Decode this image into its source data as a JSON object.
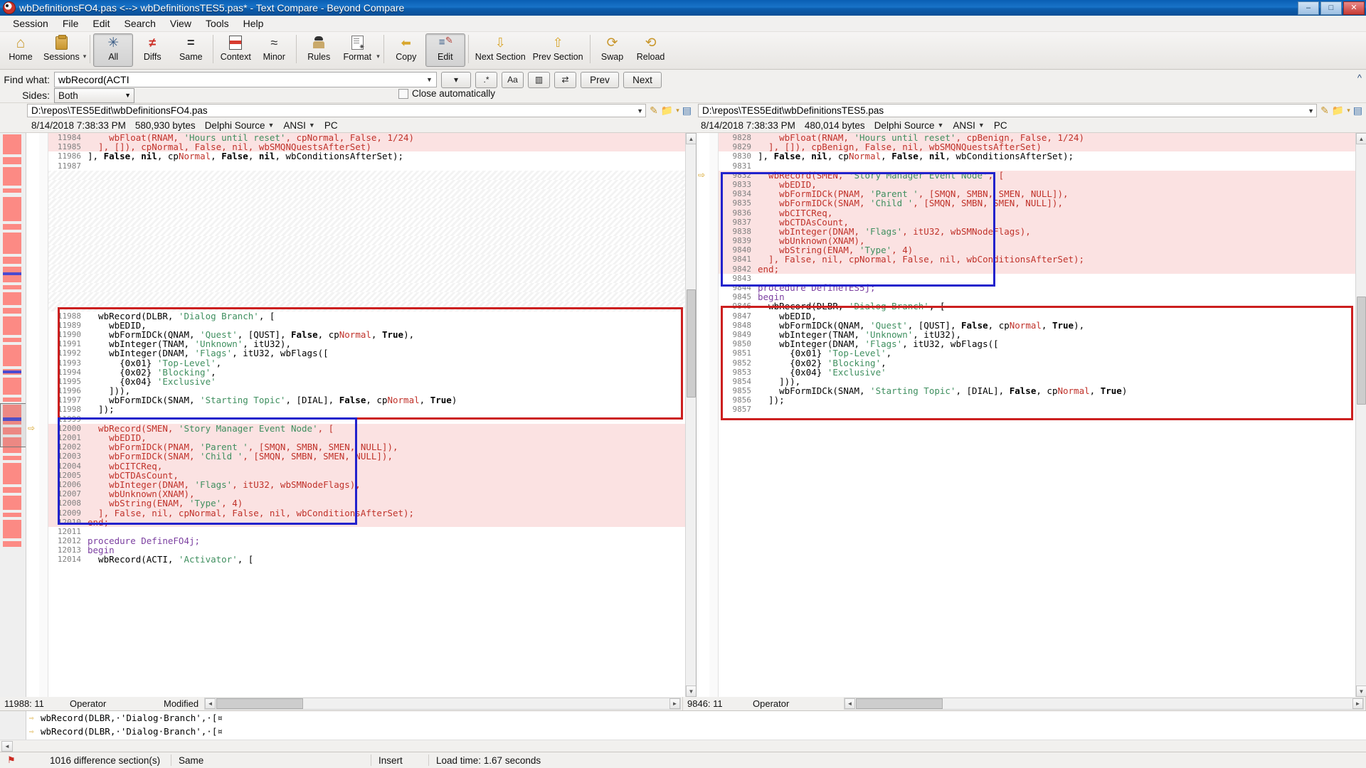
{
  "window": {
    "title": "wbDefinitionsFO4.pas <--> wbDefinitionsTES5.pas* - Text Compare - Beyond Compare",
    "icon": "beyond-compare-icon",
    "minimize": "–",
    "maximize": "□",
    "close": "✕"
  },
  "menu": [
    "Session",
    "File",
    "Edit",
    "Search",
    "View",
    "Tools",
    "Help"
  ],
  "toolbar": [
    {
      "label": "Home",
      "icon": "home-icon",
      "pressed": false
    },
    {
      "label": "Sessions",
      "icon": "sessions-icon",
      "pressed": false,
      "caret": true
    },
    {
      "label": "All",
      "icon": "all-icon",
      "pressed": true
    },
    {
      "label": "Diffs",
      "icon": "diffs-icon",
      "pressed": false
    },
    {
      "label": "Same",
      "icon": "same-icon",
      "pressed": false
    },
    {
      "label": "Context",
      "icon": "context-icon",
      "pressed": false
    },
    {
      "label": "Minor",
      "icon": "minor-icon",
      "pressed": false
    },
    {
      "label": "Rules",
      "icon": "rules-icon",
      "pressed": false
    },
    {
      "label": "Format",
      "icon": "format-icon",
      "pressed": false,
      "caret": true
    },
    {
      "label": "Copy",
      "icon": "copy-left-icon",
      "pressed": false
    },
    {
      "label": "Edit",
      "icon": "edit-icon",
      "pressed": true
    },
    {
      "label": "Next Section",
      "icon": "arrow-down-icon",
      "pressed": false
    },
    {
      "label": "Prev Section",
      "icon": "arrow-up-icon",
      "pressed": false
    },
    {
      "label": "Swap",
      "icon": "swap-icon",
      "pressed": false
    },
    {
      "label": "Reload",
      "icon": "reload-icon",
      "pressed": false
    }
  ],
  "find": {
    "label": "Find what:",
    "value": "wbRecord(ACTI",
    "placeholder": "",
    "history_button": "▾",
    "regex_button": ".*",
    "case_button": "Aa",
    "wholeword_button": "▥",
    "wrap_button": "⇄",
    "prev_button": "Prev",
    "next_button": "Next",
    "sides_label": "Sides:",
    "sides_value": "Both",
    "close_automatically_label": "Close automatically",
    "close_automatically_checked": false,
    "collapse_icon": "^"
  },
  "left_file": {
    "path": "D:\\repos\\TES5Edit\\wbDefinitionsFO4.pas",
    "timestamp": "8/14/2018 7:38:33 PM",
    "size": "580,930 bytes",
    "format": "Delphi Source",
    "encoding": "ANSI",
    "linebreak": "PC"
  },
  "right_file": {
    "path": "D:\\repos\\TES5Edit\\wbDefinitionsTES5.pas",
    "timestamp": "8/14/2018 7:38:33 PM",
    "size": "480,014 bytes",
    "format": "Delphi Source",
    "encoding": "ANSI",
    "linebreak": "PC"
  },
  "left_lines": [
    {
      "n": "11984",
      "t": "    wbFloat(RNAM, 'Hours until reset', cpNormal, False, 1/24)",
      "cls": "diff"
    },
    {
      "n": "11985",
      "t": "  ], []), cpNormal, False, nil, wbSMQNQuestsAfterSet)",
      "cls": "diff"
    },
    {
      "n": "11986",
      "t": "], False, nil, cpNormal, False, nil, wbConditionsAfterSet);",
      "cls": "same"
    },
    {
      "n": "11987",
      "t": "",
      "cls": "same"
    },
    {
      "n": "",
      "t": "",
      "cls": "hatch"
    },
    {
      "n": "",
      "t": "",
      "cls": "hatch"
    },
    {
      "n": "",
      "t": "",
      "cls": "hatch"
    },
    {
      "n": "",
      "t": "",
      "cls": "hatch"
    },
    {
      "n": "",
      "t": "",
      "cls": "hatch"
    },
    {
      "n": "",
      "t": "",
      "cls": "hatch"
    },
    {
      "n": "",
      "t": "",
      "cls": "hatch"
    },
    {
      "n": "",
      "t": "",
      "cls": "hatch"
    },
    {
      "n": "",
      "t": "",
      "cls": "hatch"
    },
    {
      "n": "",
      "t": "",
      "cls": "hatch"
    },
    {
      "n": "",
      "t": "",
      "cls": "hatch"
    },
    {
      "n": "",
      "t": "",
      "cls": "hatch"
    },
    {
      "n": "",
      "t": "",
      "cls": "hatch"
    },
    {
      "n": "",
      "t": "",
      "cls": "hatch"
    },
    {
      "n": "",
      "t": "",
      "cls": "hatch"
    },
    {
      "n": "11988",
      "t": "  wbRecord(DLBR, 'Dialog Branch', [",
      "cls": "same"
    },
    {
      "n": "11989",
      "t": "    wbEDID,",
      "cls": "same"
    },
    {
      "n": "11990",
      "t": "    wbFormIDCk(QNAM, 'Quest', [QUST], False, cpNormal, True),",
      "cls": "same"
    },
    {
      "n": "11991",
      "t": "    wbInteger(TNAM, 'Unknown', itU32),",
      "cls": "same"
    },
    {
      "n": "11992",
      "t": "    wbInteger(DNAM, 'Flags', itU32, wbFlags([",
      "cls": "same"
    },
    {
      "n": "11993",
      "t": "      {0x01} 'Top-Level',",
      "cls": "same"
    },
    {
      "n": "11994",
      "t": "      {0x02} 'Blocking',",
      "cls": "same"
    },
    {
      "n": "11995",
      "t": "      {0x04} 'Exclusive'",
      "cls": "same"
    },
    {
      "n": "11996",
      "t": "    ])),",
      "cls": "same"
    },
    {
      "n": "11997",
      "t": "    wbFormIDCk(SNAM, 'Starting Topic', [DIAL], False, cpNormal, True)",
      "cls": "same"
    },
    {
      "n": "11998",
      "t": "  ]);",
      "cls": "same"
    },
    {
      "n": "11999",
      "t": "",
      "cls": "same"
    },
    {
      "n": "12000",
      "t": "  wbRecord(SMEN, 'Story Manager Event Node', [",
      "cls": "diff",
      "arrow": true
    },
    {
      "n": "12001",
      "t": "    wbEDID,",
      "cls": "diff"
    },
    {
      "n": "12002",
      "t": "    wbFormIDCk(PNAM, 'Parent ', [SMQN, SMBN, SMEN, NULL]),",
      "cls": "diff"
    },
    {
      "n": "12003",
      "t": "    wbFormIDCk(SNAM, 'Child ', [SMQN, SMBN, SMEN, NULL]),",
      "cls": "diff"
    },
    {
      "n": "12004",
      "t": "    wbCITCReq,",
      "cls": "diff"
    },
    {
      "n": "12005",
      "t": "    wbCTDAsCount,",
      "cls": "diff"
    },
    {
      "n": "12006",
      "t": "    wbInteger(DNAM, 'Flags', itU32, wbSMNodeFlags),",
      "cls": "diff"
    },
    {
      "n": "12007",
      "t": "    wbUnknown(XNAM),",
      "cls": "diff"
    },
    {
      "n": "12008",
      "t": "    wbString(ENAM, 'Type', 4)",
      "cls": "diff"
    },
    {
      "n": "12009",
      "t": "  ], False, nil, cpNormal, False, nil, wbConditionsAfterSet);",
      "cls": "diff"
    },
    {
      "n": "12010",
      "t": "end;",
      "cls": "diff"
    },
    {
      "n": "12011",
      "t": "",
      "cls": "sameblue"
    },
    {
      "n": "12012",
      "t": "procedure DefineFO4j;",
      "cls": "proc"
    },
    {
      "n": "12013",
      "t": "begin",
      "cls": "proc"
    },
    {
      "n": "12014",
      "t": "  wbRecord(ACTI, 'Activator', [",
      "cls": "same"
    }
  ],
  "right_lines": [
    {
      "n": "9828",
      "t": "    wbFloat(RNAM, 'Hours until reset', cpBenign, False, 1/24)",
      "cls": "diff"
    },
    {
      "n": "9829",
      "t": "  ], []), cpBenign, False, nil, wbSMQNQuestsAfterSet)",
      "cls": "diff"
    },
    {
      "n": "9830",
      "t": "], False, nil, cpNormal, False, nil, wbConditionsAfterSet);",
      "cls": "same"
    },
    {
      "n": "9831",
      "t": "",
      "cls": "same"
    },
    {
      "n": "9832",
      "t": "  wbRecord(SMEN, 'Story Manager Event Node', [",
      "cls": "diff",
      "arrow": true
    },
    {
      "n": "9833",
      "t": "    wbEDID,",
      "cls": "diff"
    },
    {
      "n": "9834",
      "t": "    wbFormIDCk(PNAM, 'Parent ', [SMQN, SMBN, SMEN, NULL]),",
      "cls": "diff"
    },
    {
      "n": "9835",
      "t": "    wbFormIDCk(SNAM, 'Child ', [SMQN, SMBN, SMEN, NULL]),",
      "cls": "diff"
    },
    {
      "n": "9836",
      "t": "    wbCITCReq,",
      "cls": "diff"
    },
    {
      "n": "9837",
      "t": "    wbCTDAsCount,",
      "cls": "diff"
    },
    {
      "n": "9838",
      "t": "    wbInteger(DNAM, 'Flags', itU32, wbSMNodeFlags),",
      "cls": "diff"
    },
    {
      "n": "9839",
      "t": "    wbUnknown(XNAM),",
      "cls": "diff"
    },
    {
      "n": "9840",
      "t": "    wbString(ENAM, 'Type', 4)",
      "cls": "diff"
    },
    {
      "n": "9841",
      "t": "  ], False, nil, cpNormal, False, nil, wbConditionsAfterSet);",
      "cls": "diff"
    },
    {
      "n": "9842",
      "t": "end;",
      "cls": "diff"
    },
    {
      "n": "9843",
      "t": "",
      "cls": "same"
    },
    {
      "n": "9844",
      "t": "procedure DefineTES5j;",
      "cls": "proc"
    },
    {
      "n": "9845",
      "t": "begin",
      "cls": "proc"
    },
    {
      "n": "9846",
      "t": "  wbRecord(DLBR, 'Dialog Branch', [",
      "cls": "same"
    },
    {
      "n": "9847",
      "t": "    wbEDID,",
      "cls": "same"
    },
    {
      "n": "9848",
      "t": "    wbFormIDCk(QNAM, 'Quest', [QUST], False, cpNormal, True),",
      "cls": "same"
    },
    {
      "n": "9849",
      "t": "    wbInteger(TNAM, 'Unknown', itU32),",
      "cls": "same"
    },
    {
      "n": "9850",
      "t": "    wbInteger(DNAM, 'Flags', itU32, wbFlags([",
      "cls": "same"
    },
    {
      "n": "9851",
      "t": "      {0x01} 'Top-Level',",
      "cls": "same"
    },
    {
      "n": "9852",
      "t": "      {0x02} 'Blocking',",
      "cls": "same"
    },
    {
      "n": "9853",
      "t": "      {0x04} 'Exclusive'",
      "cls": "same"
    },
    {
      "n": "9854",
      "t": "    ])),",
      "cls": "same"
    },
    {
      "n": "9855",
      "t": "    wbFormIDCk(SNAM, 'Starting Topic', [DIAL], False, cpNormal, True)",
      "cls": "same"
    },
    {
      "n": "9856",
      "t": "  ]);",
      "cls": "same"
    },
    {
      "n": "9857",
      "t": "",
      "cls": "same"
    }
  ],
  "left_status": {
    "position": "11988: 11",
    "operator": "Operator",
    "state": "Modified"
  },
  "right_status": {
    "position": "9846: 11",
    "operator": "Operator",
    "state": ""
  },
  "detail_lines": [
    {
      "arrow": "⇨",
      "text": "wbRecord(DLBR,·'Dialog·Branch',·[¤"
    },
    {
      "arrow": "⇨",
      "text": "wbRecord(DLBR,·'Dialog·Branch',·[¤"
    }
  ],
  "statusbar": {
    "differences": "1016 difference section(s)",
    "same": "Same",
    "insert_mode": "Insert",
    "load_time": "Load time: 1.67 seconds",
    "flag_icon": "flag-icon"
  },
  "colors": {
    "diff_bg": "#fbe2e2",
    "diff_fg": "#c0322a",
    "string": "#3f8f5f",
    "box_red": "#cc1f1f",
    "box_blue": "#2222cc",
    "titlebar": "#1873c8"
  }
}
